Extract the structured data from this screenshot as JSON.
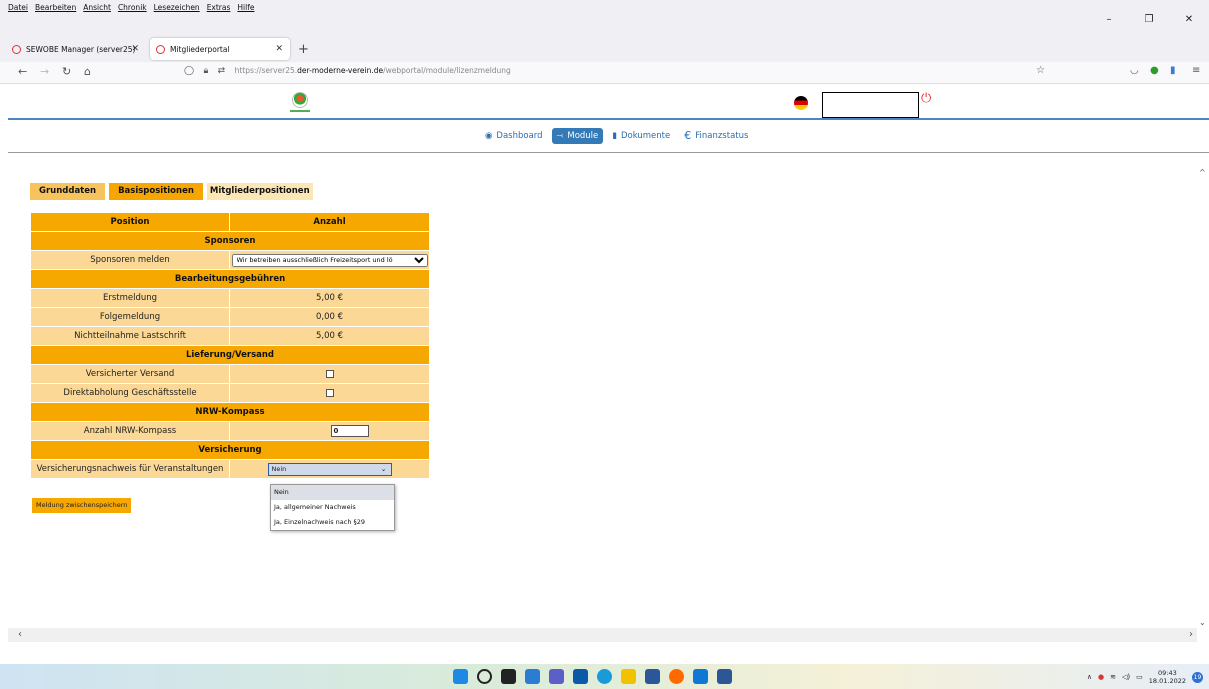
{
  "browser": {
    "menus": [
      "Datei",
      "Bearbeiten",
      "Ansicht",
      "Chronik",
      "Lesezeichen",
      "Extras",
      "Hilfe"
    ],
    "window_controls": {
      "minimize": "–",
      "maximize": "❐",
      "close": "✕"
    },
    "tabs": [
      {
        "title": "SEWOBE Manager (server25)",
        "active": false
      },
      {
        "title": "Mitgliederportal",
        "active": true
      }
    ],
    "new_tab": "+",
    "url": {
      "prefix": "https://server25.",
      "domain": "der-moderne-verein.de",
      "path": "/webportal/module/lizenzmeldung"
    }
  },
  "nav": {
    "items": [
      {
        "label": "Dashboard",
        "icon": "dashboard-icon"
      },
      {
        "label": "Module",
        "icon": "share-icon",
        "active": true
      },
      {
        "label": "Dokumente",
        "icon": "document-icon"
      },
      {
        "label": "Finanzstatus",
        "icon": "euro-icon"
      }
    ]
  },
  "subtabs": [
    "Grunddaten",
    "Basispositionen",
    "Mitgliederpositionen"
  ],
  "table": {
    "headers": [
      "Position",
      "Anzahl"
    ],
    "sections": {
      "sponsoren": "Sponsoren",
      "gebuehren": "Bearbeitungsgebühren",
      "lieferung": "Lieferung/Versand",
      "nrw": "NRW-Kompass",
      "versicherung": "Versicherung"
    },
    "rows": {
      "sponsoren_melden": {
        "label": "Sponsoren melden",
        "value": "Wir betreiben ausschließlich Freizeitsport und lö"
      },
      "erstmeldung": {
        "label": "Erstmeldung",
        "value": "5,00 €"
      },
      "folgemeldung": {
        "label": "Folgemeldung",
        "value": "0,00 €"
      },
      "nichtteilnahme": {
        "label": "Nichtteilnahme Lastschrift",
        "value": "5,00 €"
      },
      "versicherter_versand": {
        "label": "Versicherter Versand"
      },
      "direktabholung": {
        "label": "Direktabholung Geschäftsstelle"
      },
      "nrw_kompass": {
        "label": "Anzahl NRW-Kompass",
        "value": "0"
      },
      "versicherungsnachweis": {
        "label": "Versicherungsnachweis für Veranstaltungen",
        "value": "Nein"
      }
    }
  },
  "dropdown_options": [
    "Nein",
    "Ja, allgemeiner Nachweis",
    "Ja, Einzelnachweis nach §29"
  ],
  "save_button": "Meldung zwischenspeichern",
  "taskbar": {
    "time": "09:43",
    "date": "18.01.2022",
    "notifications": "19"
  },
  "colors": {
    "accent_orange": "#f6a800",
    "cell_light": "#fbd895",
    "nav_blue": "#337ab7"
  }
}
